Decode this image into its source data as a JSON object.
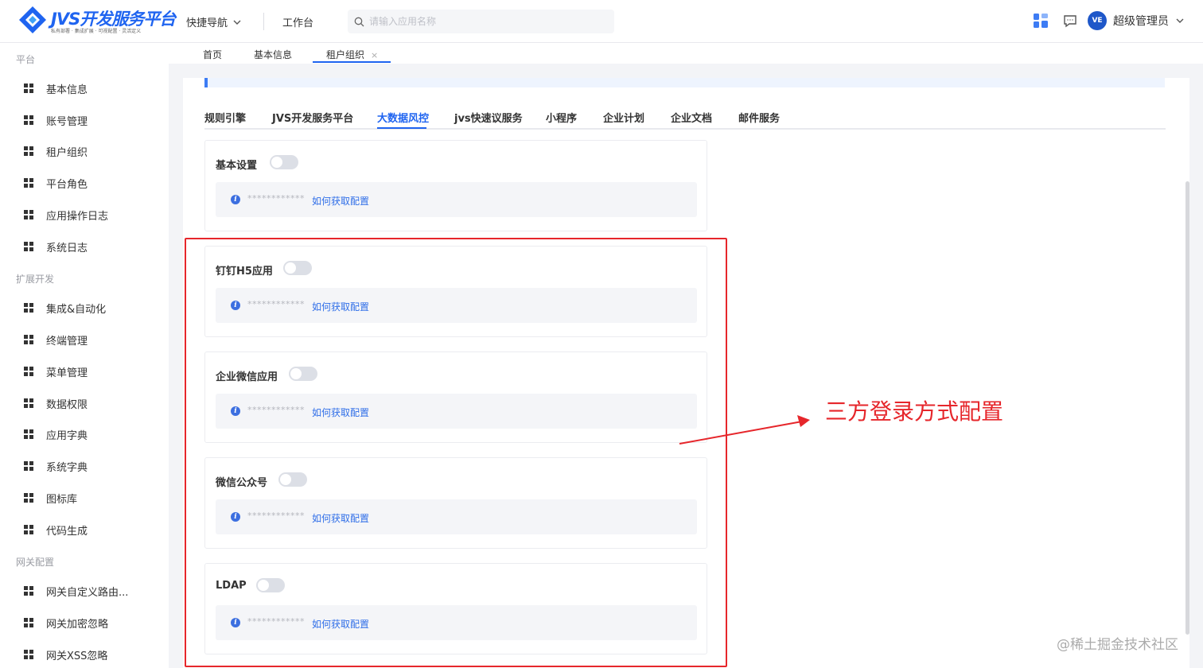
{
  "header": {
    "logo_text": "JVS开发服务平台",
    "logo_sub": "私有部署 · 集成扩展 · 可视配置 · 灵活定义",
    "quick_nav": "快捷导航",
    "workbench": "工作台",
    "search_placeholder": "请输入应用名称",
    "avatar_text": "VE",
    "username": "超级管理员"
  },
  "sidebar": {
    "group_platform": "平台",
    "platform_items": [
      "基本信息",
      "账号管理",
      "租户组织",
      "平台角色",
      "应用操作日志",
      "系统日志"
    ],
    "group_ext": "扩展开发",
    "ext_items": [
      "集成&自动化",
      "终端管理",
      "菜单管理",
      "数据权限",
      "应用字典",
      "系统字典",
      "图标库",
      "代码生成"
    ],
    "group_gateway": "网关配置",
    "gateway_items": [
      "网关自定义路由...",
      "网关加密忽略",
      "网关XSS忽略"
    ]
  },
  "top_tabs": [
    "首页",
    "基本信息",
    "租户组织"
  ],
  "sub_tabs": [
    "规则引擎",
    "JVS开发服务平台",
    "大数据风控",
    "jvs快速议服务",
    "小程序",
    "企业计划",
    "企业文档",
    "邮件服务"
  ],
  "sections": [
    {
      "title": "基本设置",
      "mask": "************",
      "link": "如何获取配置",
      "enabled": false
    },
    {
      "title": "钉钉H5应用",
      "mask": "************",
      "link": "如何获取配置",
      "enabled": false
    },
    {
      "title": "企业微信应用",
      "mask": "************",
      "link": "如何获取配置",
      "enabled": false
    },
    {
      "title": "微信公众号",
      "mask": "************",
      "link": "如何获取配置",
      "enabled": false
    },
    {
      "title": "LDAP",
      "mask": "************",
      "link": "如何获取配置",
      "enabled": false
    }
  ],
  "annotation": {
    "text": "三方登录方式配置",
    "color": "#e6262b"
  },
  "watermark": "@稀土掘金技术社区",
  "colors": {
    "accent": "#1f64f0",
    "annotation": "#e6262b"
  }
}
